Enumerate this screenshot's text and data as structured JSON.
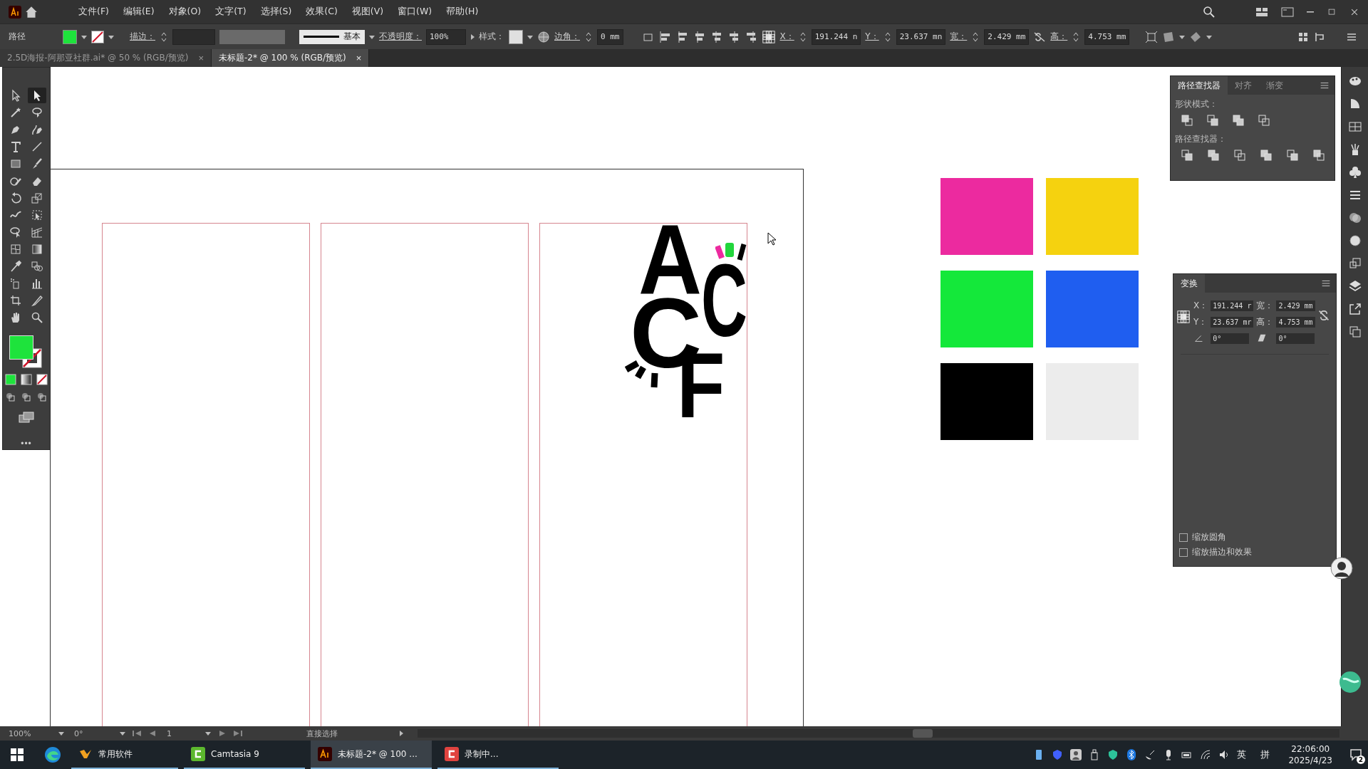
{
  "menu": {
    "items": [
      "文件(F)",
      "编辑(E)",
      "对象(O)",
      "文字(T)",
      "选择(S)",
      "效果(C)",
      "视图(V)",
      "窗口(W)",
      "帮助(H)"
    ]
  },
  "control_bar": {
    "selection_label": "路径",
    "stroke_label": "描边：",
    "stroke_style": "基本",
    "opacity_label": "不透明度：",
    "opacity": "100%",
    "style_label": "样式：",
    "corner_label": "边角：",
    "corner": "0 mm",
    "x_label": "X：",
    "x": "191.244 n",
    "y_label": "Y：",
    "y": "23.637 mn",
    "w_label": "宽：",
    "w": "2.429 mm",
    "h_label": "高：",
    "h": "4.753 mm"
  },
  "tabs": [
    {
      "label": "2.5D海报-阿那亚社群.ai* @ 50 % (RGB/预览)",
      "close": "×",
      "selected": false
    },
    {
      "label": "未标题-2* @ 100 % (RGB/预览)",
      "close": "×",
      "selected": true
    }
  ],
  "toolbar": {
    "tools": [
      {
        "kind": "selection",
        "selected": false
      },
      {
        "kind": "direct",
        "selected": true
      },
      {
        "kind": "wand",
        "selected": false
      },
      {
        "kind": "lasso",
        "selected": false
      },
      {
        "kind": "pen",
        "selected": false
      },
      {
        "kind": "curvature",
        "selected": false
      },
      {
        "kind": "type",
        "selected": false
      },
      {
        "kind": "line",
        "selected": false
      },
      {
        "kind": "rect",
        "selected": false
      },
      {
        "kind": "brush",
        "selected": false
      },
      {
        "kind": "shaper",
        "selected": false
      },
      {
        "kind": "eraser",
        "selected": false
      },
      {
        "kind": "rotate",
        "selected": false
      },
      {
        "kind": "scale",
        "selected": false
      },
      {
        "kind": "warp",
        "selected": false
      },
      {
        "kind": "freetransform",
        "selected": false
      },
      {
        "kind": "shapebuilder",
        "selected": false
      },
      {
        "kind": "perspective",
        "selected": false
      },
      {
        "kind": "mesh",
        "selected": false
      },
      {
        "kind": "gradient",
        "selected": false
      },
      {
        "kind": "eyedropper",
        "selected": false
      },
      {
        "kind": "blend",
        "selected": false
      },
      {
        "kind": "sprayer",
        "selected": false
      },
      {
        "kind": "graph",
        "selected": false
      },
      {
        "kind": "artboard",
        "selected": false
      },
      {
        "kind": "knife",
        "selected": false
      },
      {
        "kind": "hand",
        "selected": false
      },
      {
        "kind": "zoom",
        "selected": false
      }
    ],
    "more": "•••"
  },
  "artwork": {
    "letters": [
      "A",
      "C",
      "C",
      "F"
    ]
  },
  "swatches": [
    {
      "color": "#ec2a9f"
    },
    {
      "color": "#f5d20f"
    },
    {
      "color": "#14e83a"
    },
    {
      "color": "#1f5ef0"
    },
    {
      "color": "#000000"
    },
    {
      "color": "#ececec"
    }
  ],
  "pathfinder_panel": {
    "tabs": [
      {
        "label": "路径查找器",
        "selected": true
      },
      {
        "label": "对齐",
        "selected": false
      },
      {
        "label": "渐变",
        "selected": false
      }
    ],
    "shape_modes_label": "形状模式：",
    "pathfinders_label": "路径查找器："
  },
  "transform_panel": {
    "title": "变换",
    "fields": [
      {
        "label": "X：",
        "value": "191.244 r"
      },
      {
        "label": "宽：",
        "value": "2.429 mm"
      },
      {
        "label": "Y：",
        "value": "23.637 mr"
      },
      {
        "label": "高：",
        "value": "4.753 mm"
      }
    ],
    "angle": "0°",
    "shear": "0°",
    "options": [
      {
        "label": "缩放圆角",
        "checked": false
      },
      {
        "label": "缩放描边和效果",
        "checked": false
      }
    ]
  },
  "status_bar": {
    "zoom": "100%",
    "rotation": "0°",
    "artboard": "1",
    "tool": "直接选择"
  },
  "taskbar": {
    "apps": [
      {
        "label": "常用软件",
        "active": false
      },
      {
        "label": "Camtasia 9",
        "active": false
      },
      {
        "label": "未标题-2* @ 100 ...",
        "active": true
      },
      {
        "label": "录制中...",
        "active": false
      }
    ],
    "ime_lang": "英",
    "ime_mode": "拼",
    "time": "22:06:00",
    "date": "2025/4/23",
    "notifications": "2"
  }
}
